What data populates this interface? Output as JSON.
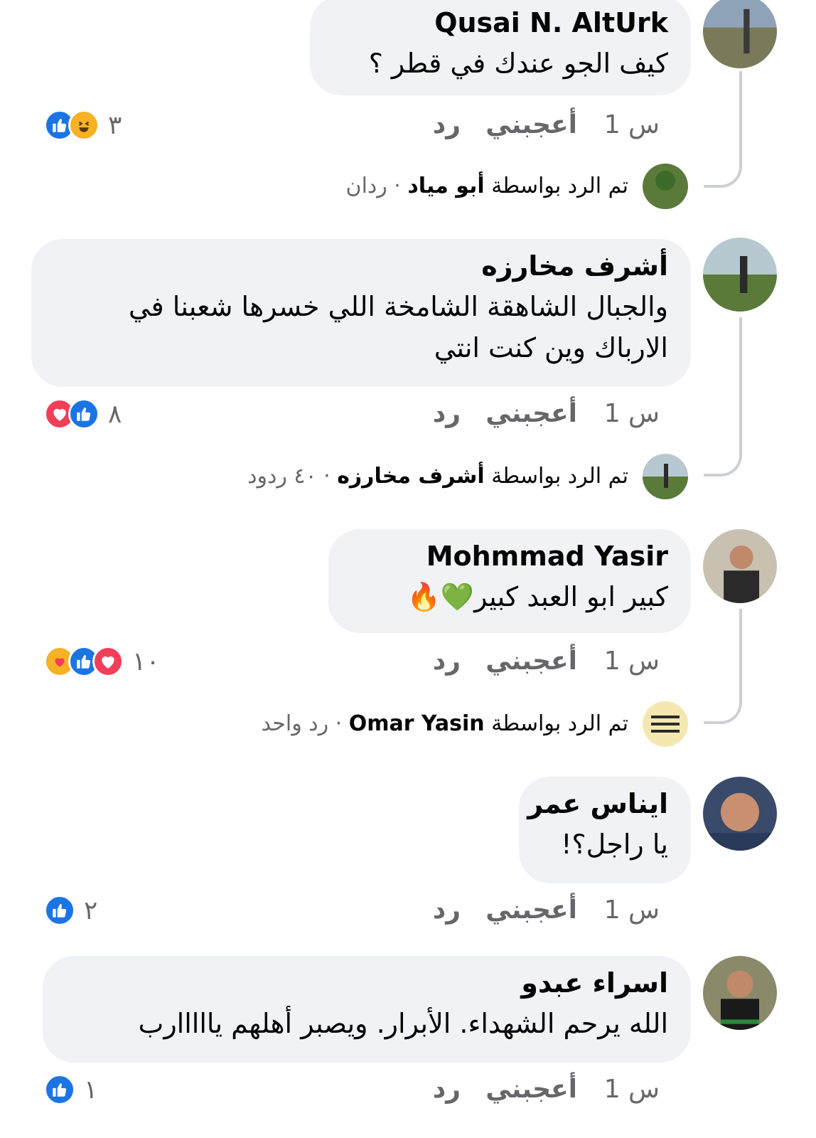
{
  "comments": [
    {
      "author": "Qusai N. AltUrk",
      "text": "كيف الجو عندك في قطر ؟",
      "time": "1 س",
      "like_label": "أعجبني",
      "reply_label": "رد",
      "reaction_count": "٣",
      "reactions": [
        "like-icon",
        "haha-icon"
      ],
      "replies": {
        "prefix": "تم الرد بواسطة",
        "by": "أبو مياد",
        "count": "· ردان"
      }
    },
    {
      "author": "أشرف مخارزه",
      "text": "والجبال الشاهقة الشامخة اللي خسرها شعبنا في الارباك وين كنت انتي",
      "time": "1 س",
      "like_label": "أعجبني",
      "reply_label": "رد",
      "reaction_count": "٨",
      "reactions": [
        "love-icon",
        "like-icon"
      ],
      "replies": {
        "prefix": "تم الرد بواسطة",
        "by": "أشرف مخارزه",
        "count": "· ٤٠ ردود"
      }
    },
    {
      "author": "Mohmmad Yasir",
      "text": "كبير ابو العبد كبير💚🔥",
      "time": "1 س",
      "like_label": "أعجبني",
      "reply_label": "رد",
      "reaction_count": "١٠",
      "reactions": [
        "care-icon",
        "like-icon",
        "love-icon"
      ],
      "replies": {
        "prefix": "تم الرد بواسطة",
        "by": "Omar Yasin",
        "count": "· رد واحد"
      }
    },
    {
      "author": "ايناس عمر",
      "text": "يا راجل؟!",
      "time": "1 س",
      "like_label": "أعجبني",
      "reply_label": "رد",
      "reaction_count": "٢",
      "reactions": [
        "like-icon"
      ]
    },
    {
      "author": "اسراء عبدو",
      "text": "الله يرحم الشهداء. الأبرار. ويصبر أهلهم يااااارب",
      "time": "1 س",
      "like_label": "أعجبني",
      "reply_label": "رد",
      "reaction_count": "١",
      "reactions": [
        "like-icon"
      ]
    }
  ],
  "colors": {
    "bubble": "#f0f2f5",
    "meta_text": "#65676b",
    "like_blue": "#1b74e4",
    "love_red": "#f33e58",
    "haha_yellow": "#f7b125"
  }
}
